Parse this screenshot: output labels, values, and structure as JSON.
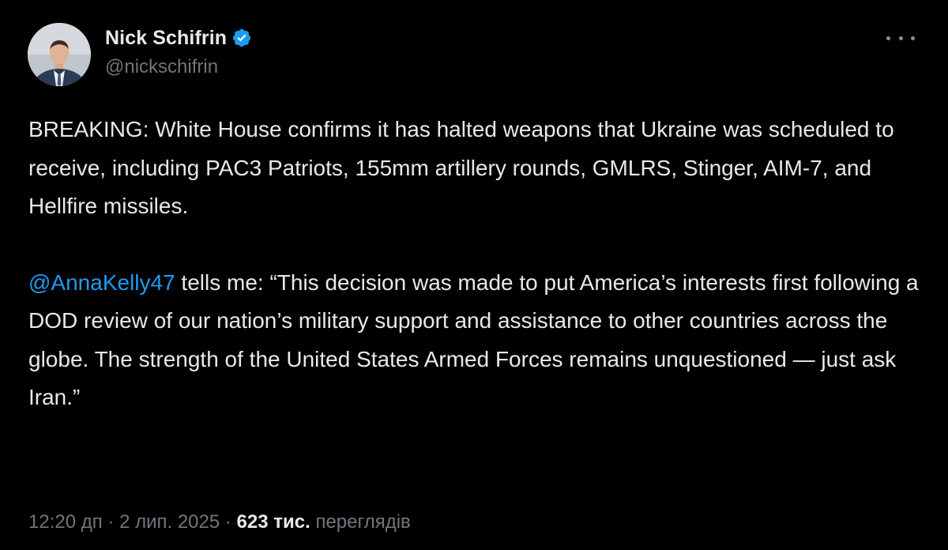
{
  "author": {
    "display_name": "Nick Schifrin",
    "handle": "@nickschifrin",
    "verified_icon": "verified-badge-icon",
    "avatar_icon": "avatar-photo"
  },
  "menu": {
    "more_icon": "more-options-icon"
  },
  "tweet": {
    "paragraph1": "BREAKING: White House confirms it has halted weapons that Ukraine was scheduled to receive, including PAC3 Patriots, 155mm artillery rounds, GMLRS, Stinger, AIM-7, and Hellfire missiles.",
    "mention": "@AnnaKelly47",
    "paragraph2_rest": " tells me: “This decision was made to put America’s interests first following a DOD review of our nation’s military support and assistance to other countries across the globe. The strength of the United States Armed Forces remains unquestioned — just ask Iran.”"
  },
  "meta": {
    "time": "12:20 дп",
    "separator1": " · ",
    "date": "2 лип. 2025",
    "separator2": " · ",
    "views_count": "623 тис.",
    "views_label": " переглядів"
  },
  "colors": {
    "background": "#000000",
    "text": "#e7e9ea",
    "secondary": "#71767b",
    "link": "#1d9bf0"
  }
}
